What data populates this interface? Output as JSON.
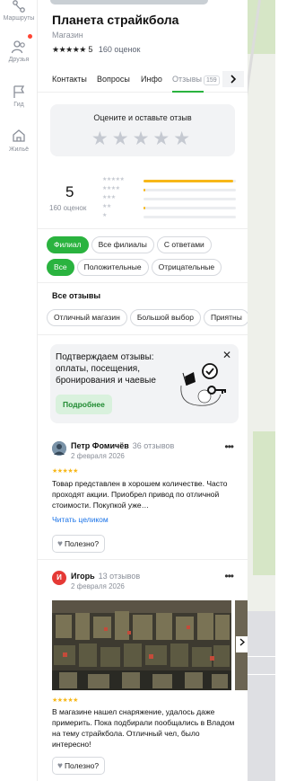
{
  "sidebar": {
    "items": [
      {
        "label": "Маршруты",
        "icon": "route-icon"
      },
      {
        "label": "Друзья",
        "icon": "friends-icon"
      },
      {
        "label": "Гид",
        "icon": "guide-flag-icon"
      },
      {
        "label": "Жильё",
        "icon": "housing-icon"
      }
    ]
  },
  "place": {
    "name": "Планета страйкбола",
    "category": "Магазин",
    "stars": "★★★★★",
    "rating": "5",
    "reviews_count": "160 оценок"
  },
  "tabs": [
    {
      "label": "Контакты"
    },
    {
      "label": "Вопросы"
    },
    {
      "label": "Инфо"
    },
    {
      "label": "Отзывы",
      "badge": "159",
      "active": true
    }
  ],
  "tabs_more_icon": "chevron-right-icon",
  "rate_prompt": {
    "text": "Оцените и оставьте отзыв",
    "stars": "★★★★★"
  },
  "summary": {
    "rating": "5",
    "count": "160 оценок",
    "distribution": [
      {
        "stars": "★★★★★",
        "share": 0.97
      },
      {
        "stars": "★★★★",
        "share": 0.02
      },
      {
        "stars": "★★★",
        "share": 0.0
      },
      {
        "stars": "★★",
        "share": 0.01
      },
      {
        "stars": "★",
        "share": 0.0
      }
    ]
  },
  "branch_filters": [
    {
      "label": "Филиал",
      "selected": true
    },
    {
      "label": "Все филиалы",
      "selected": false
    },
    {
      "label": "С ответами",
      "selected": false
    }
  ],
  "sentiment_filters": [
    {
      "label": "Все",
      "selected": true
    },
    {
      "label": "Положительные",
      "selected": false
    },
    {
      "label": "Отрицательные",
      "selected": false
    }
  ],
  "all_reviews_heading": "Все отзывы",
  "topics": [
    {
      "label": "Отличный магазин"
    },
    {
      "label": "Большой выбор"
    },
    {
      "label": "Приятны"
    }
  ],
  "promo": {
    "text": "Подтверждаем отзывы: оплаты, посещения, бронирования и чаевые",
    "button": "Подробнее",
    "close": "✕"
  },
  "reviews": [
    {
      "author": "Петр Фомичёв",
      "author_reviews": "36 отзывов",
      "date": "2 февраля 2026",
      "stars": "★★★★★",
      "text": "Товар представлен в хорошем количестве. Часто проходят акции. Приобрел привод по отличной стоимости. Покупкой уже…",
      "read_more": "Читать целиком",
      "useful": "Полезно?"
    },
    {
      "author": "Игорь",
      "avatar_letter": "И",
      "author_reviews": "13 отзывов",
      "date": "2 февраля 2026",
      "stars": "★★★★★",
      "text": "В магазине нашел снаряжение, удалось даже примерить. Пока подбирали пообщались в Владом на тему страйкбола. Отличный чел, было интересно!",
      "useful": "Полезно?"
    }
  ],
  "colors": {
    "accent_green": "#2ab33f",
    "star_yellow": "#f7b718",
    "link_blue": "#1a73e8",
    "badge_red": "#e53935"
  }
}
